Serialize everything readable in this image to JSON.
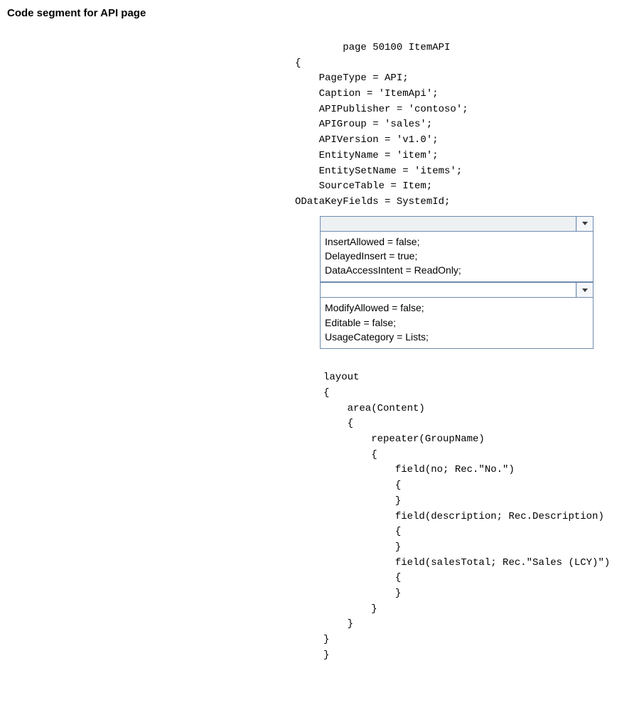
{
  "heading": "Code segment for API page",
  "code_top": "        page 50100 ItemAPI\n{\n    PageType = API;\n    Caption = 'ItemApi';\n    APIPublisher = 'contoso';\n    APIGroup = 'sales';\n    APIVersion = 'v1.0';\n    EntityName = 'item';\n    EntitySetName = 'items';\n    SourceTable = Item;\nODataKeyFields = SystemId;",
  "dropdown1": {
    "options": [
      "InsertAllowed = false;",
      "DelayedInsert = true;",
      "DataAccessIntent = ReadOnly;"
    ]
  },
  "dropdown2": {
    "options": [
      "ModifyAllowed = false;",
      "Editable = false;",
      "UsageCategory = Lists;"
    ]
  },
  "code_bottom": "layout\n{\n    area(Content)\n    {\n        repeater(GroupName)\n        {\n            field(no; Rec.\"No.\")\n            {\n            }\n            field(description; Rec.Description)\n            {\n            }\n            field(salesTotal; Rec.\"Sales (LCY)\")\n            {\n            }\n        }\n    }\n}\n}"
}
